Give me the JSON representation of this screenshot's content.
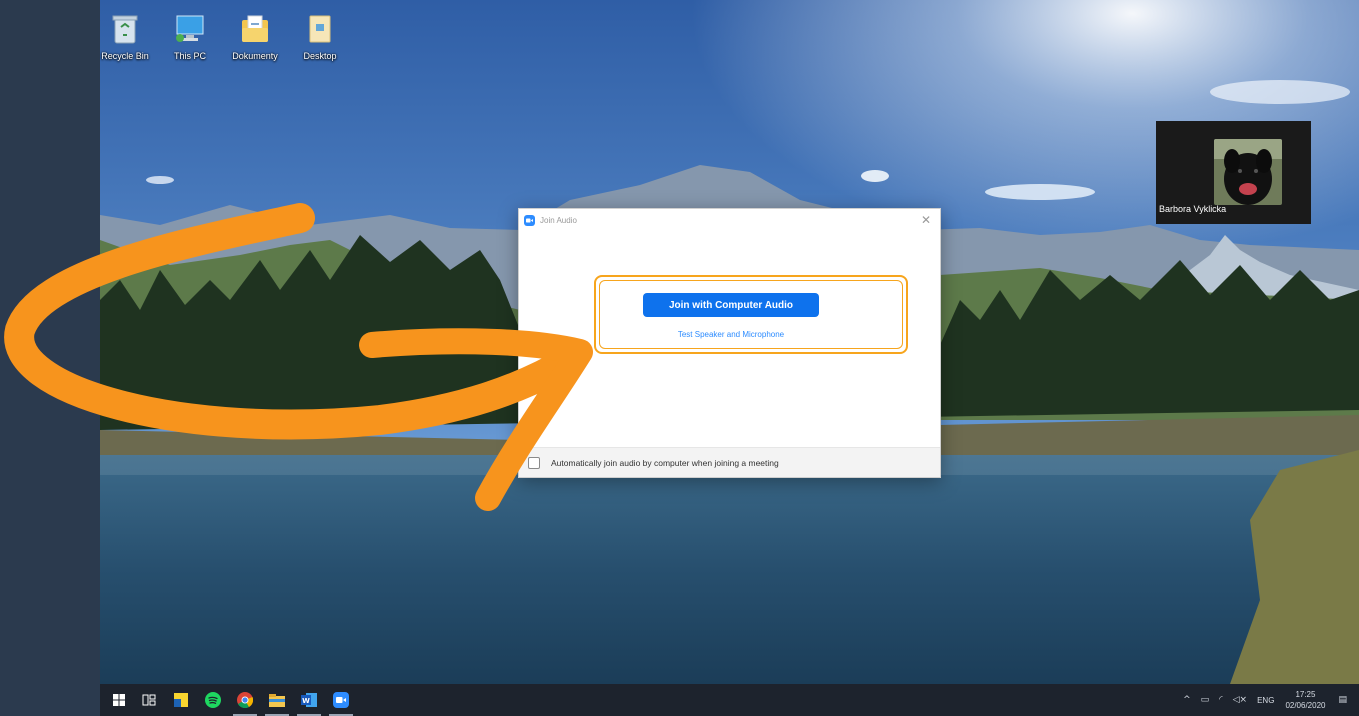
{
  "desktop": {
    "icons": [
      {
        "label": "Recycle Bin",
        "icon": "recycle-bin-icon"
      },
      {
        "label": "This PC",
        "icon": "computer-icon"
      },
      {
        "label": "Dokumenty",
        "icon": "documents-folder-icon"
      },
      {
        "label": "Desktop",
        "icon": "desktop-folder-icon"
      }
    ]
  },
  "video": {
    "participant_name": "Barbora Vyklicka"
  },
  "dialog": {
    "title": "Join Audio",
    "close_glyph": "✕",
    "join_label": "Join with Computer Audio",
    "test_label": "Test Speaker and Microphone",
    "auto_join_label": "Automatically join audio by computer when joining a meeting",
    "auto_join_checked": false
  },
  "taskbar": {
    "apps": [
      "start",
      "task-view",
      "sticky-notes",
      "spotify",
      "chrome",
      "file-explorer",
      "word",
      "zoom"
    ],
    "tray": {
      "language": "ENG",
      "time": "17:25",
      "date": "02/06/2020"
    }
  },
  "colors": {
    "highlight": "#f7a51d",
    "arrow": "#f7941d",
    "zoom_blue": "#0e72ed",
    "link_blue": "#2D8CFF"
  }
}
